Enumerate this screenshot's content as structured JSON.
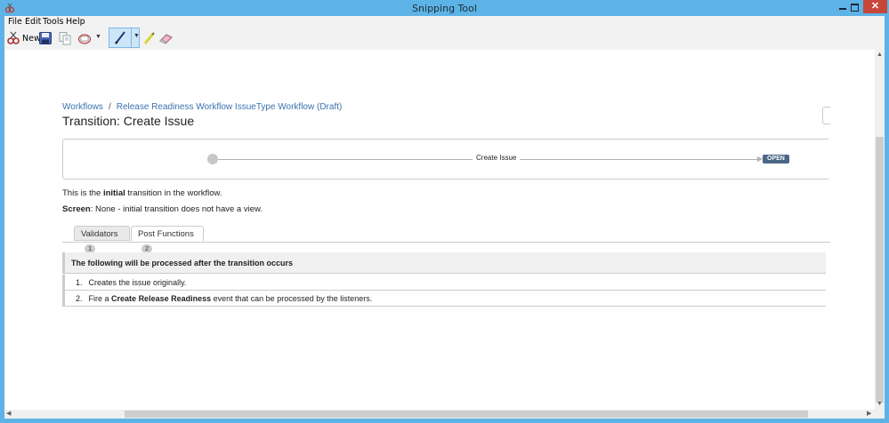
{
  "window": {
    "title": "Snipping Tool"
  },
  "menu": {
    "file": "File",
    "edit": "Edit",
    "tools": "Tools",
    "help": "Help"
  },
  "toolbar": {
    "new_label": "New"
  },
  "page": {
    "breadcrumb": {
      "root": "Workflows",
      "separator": "/",
      "current": "Release Readiness Workflow IssueType Workflow (Draft)"
    },
    "title": "Transition: Create Issue",
    "diagram": {
      "transition_label": "Create Issue",
      "target_status": "OPEN"
    },
    "description": {
      "intro_prefix": "This is the",
      "intro_bold": "initial",
      "intro_suffix": "transition in the workflow.",
      "screen_label": "Screen",
      "screen_value": ": None - initial transition does not have a view."
    },
    "tabs": [
      {
        "label": "Validators",
        "count": "1"
      },
      {
        "label": "Post Functions",
        "count": "2"
      }
    ],
    "post_functions": {
      "heading": "The following will be processed after the transition occurs",
      "items": [
        {
          "num": "1.",
          "text": "Creates the issue originally."
        },
        {
          "num": "2.",
          "prefix": "Fire a",
          "bold": "Create Release Readiness",
          "suffix": "event that can be processed by the listeners."
        }
      ]
    }
  },
  "colors": {
    "link": "#3b73af",
    "status_lozenge": "#4a6785",
    "window_frame": "#5db3e6",
    "close_button": "#c7463a"
  }
}
